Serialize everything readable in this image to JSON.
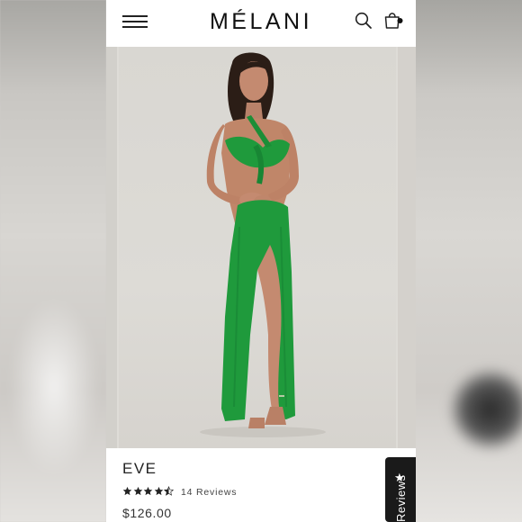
{
  "header": {
    "logo": "MÉLANI",
    "menu_icon": "hamburger-menu-icon",
    "search_icon": "search-icon",
    "cart_icon": "shopping-bag-icon"
  },
  "product": {
    "name": "EVE",
    "rating": 4.5,
    "rating_max": 5,
    "reviews_label": "14 Reviews",
    "price": "$126.00",
    "dress_color": "#1f9a3c"
  },
  "reviews_tab": {
    "icon": "star-icon",
    "label": "Reviews"
  },
  "colors": {
    "text": "#222222",
    "star": "#222222",
    "tab": "#1a1a1a"
  }
}
